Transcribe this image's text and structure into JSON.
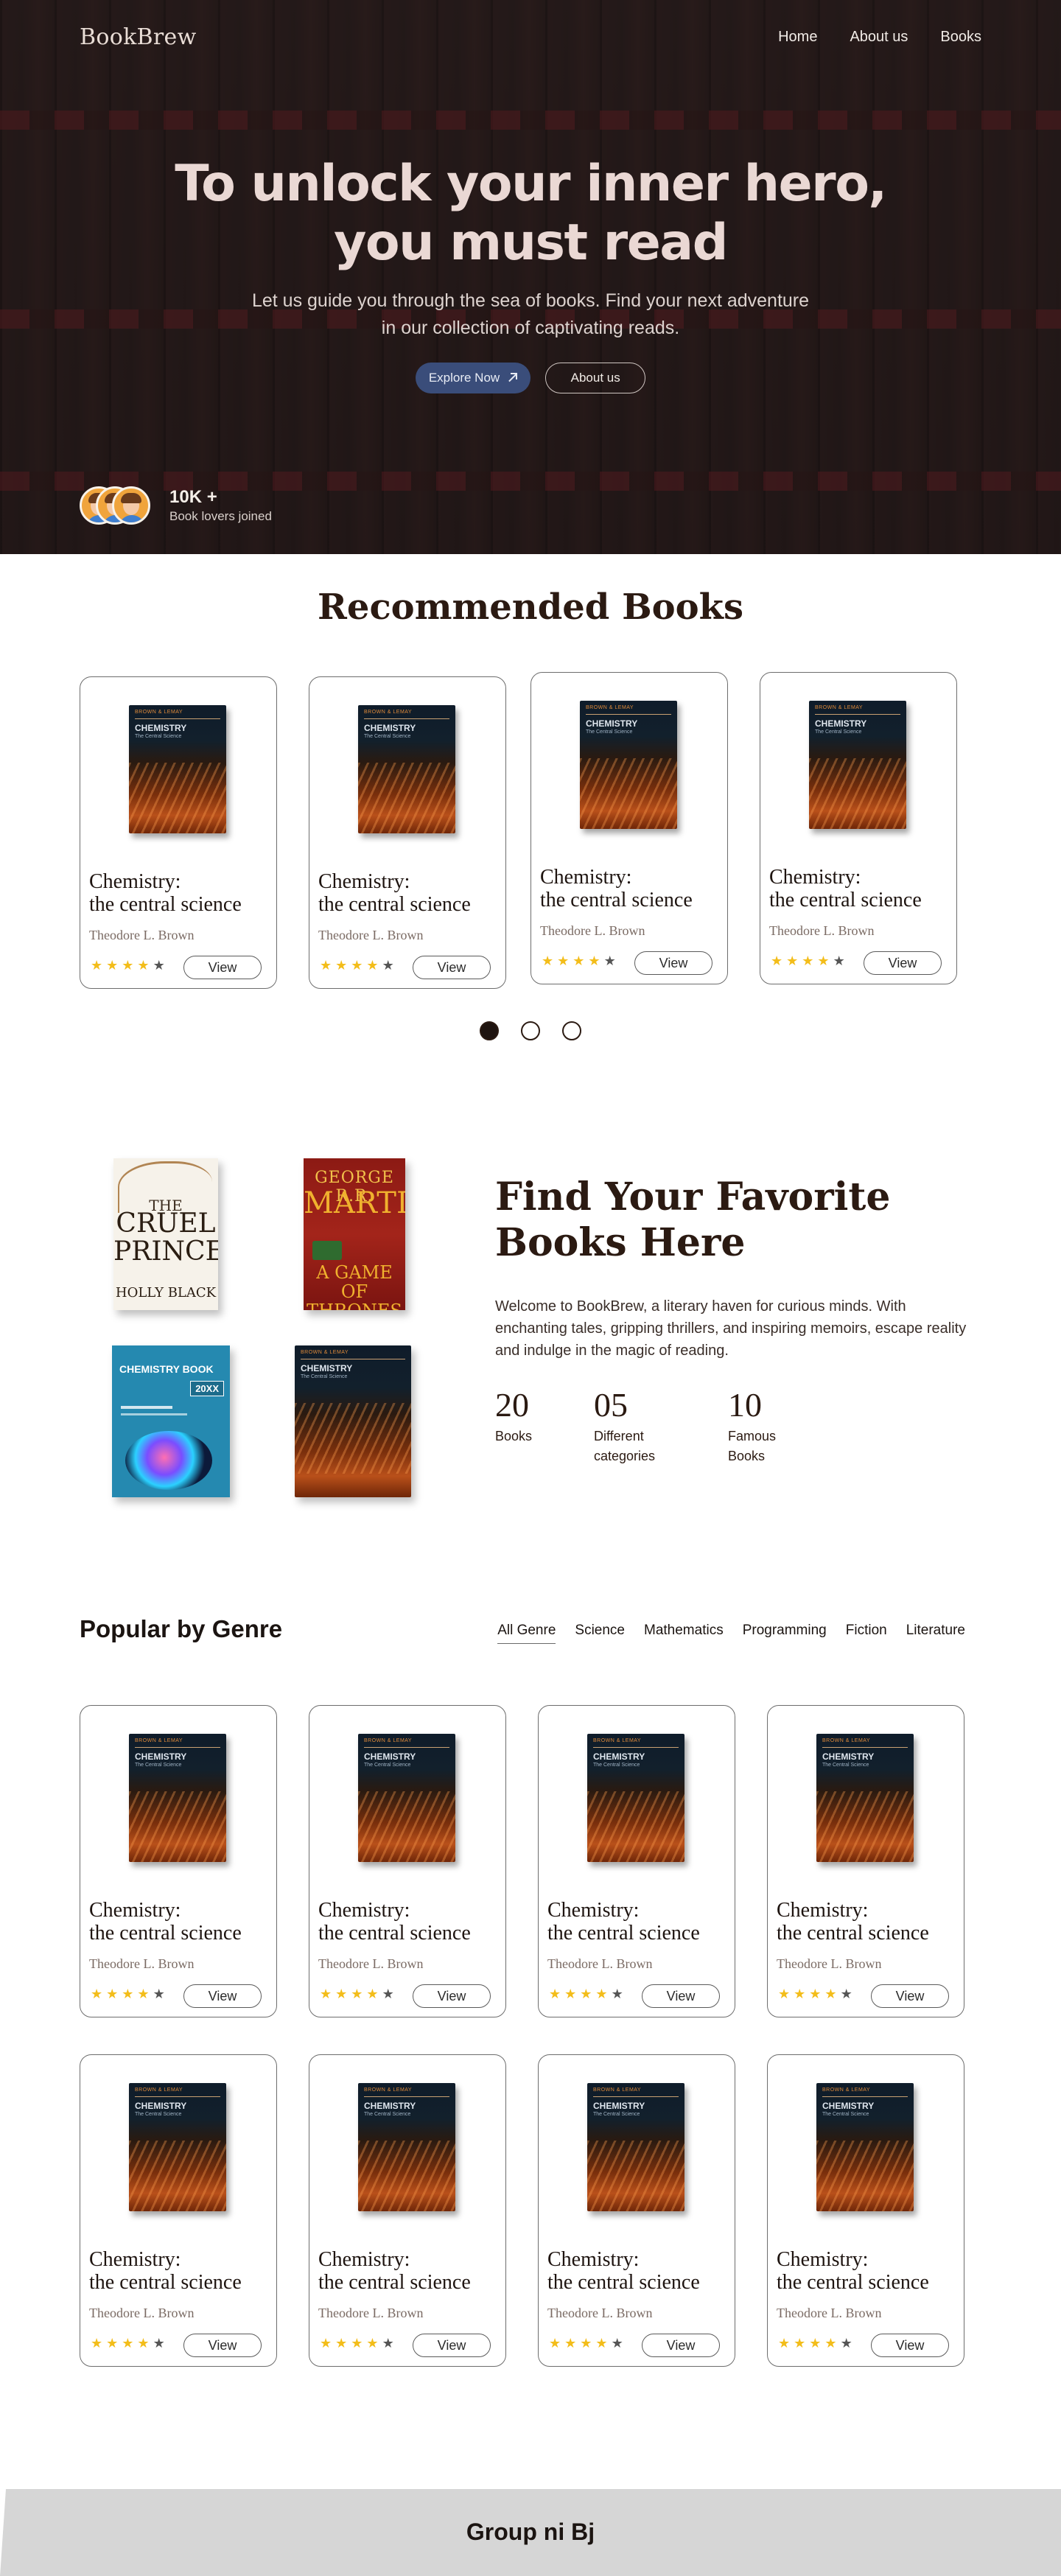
{
  "brand": {
    "logo": "BookBrew"
  },
  "nav": {
    "links": [
      "Home",
      "About us",
      "Books"
    ]
  },
  "hero": {
    "title_line1": "To unlock your inner hero,",
    "title_line2": "you must read",
    "subtitle": "Let us guide you through the sea of books. Find your next adventure in our collection of captivating reads.",
    "explore_label": "Explore Now",
    "about_label": "About us",
    "joined_count": "10K +",
    "joined_label": "Book lovers joined"
  },
  "recommended": {
    "title": "Recommended Books",
    "books": [
      {
        "title_line1": "Chemistry:",
        "title_line2": "the central science",
        "author": "Theodore L. Brown",
        "rating": 4,
        "view_label": "View"
      },
      {
        "title_line1": "Chemistry:",
        "title_line2": "the central science",
        "author": "Theodore L. Brown",
        "rating": 4,
        "view_label": "View"
      },
      {
        "title_line1": "Chemistry:",
        "title_line2": "the central science",
        "author": "Theodore L. Brown",
        "rating": 4,
        "view_label": "View"
      },
      {
        "title_line1": "Chemistry:",
        "title_line2": "the central science",
        "author": "Theodore L. Brown",
        "rating": 4,
        "view_label": "View"
      }
    ],
    "carousel_pages": 3,
    "active_page": 1
  },
  "cover_art": {
    "chem_authors": "BROWN & LEMAY",
    "chem_title": "CHEMISTRY",
    "chem_sub": "The Central Science",
    "cruel_the": "THE",
    "cruel_title": "CRUEL PRINCE",
    "cruel_author": "HOLLY BLACK",
    "thrones_author": "GEORGE R.R.",
    "thrones_name": "MARTIN",
    "thrones_title": "A GAME OF THRONES",
    "chembook_title": "CHEMISTRY BOOK",
    "chembook_year": "20XX"
  },
  "favorite": {
    "title_line1": "Find Your Favorite",
    "title_line2": "Books Here",
    "description": "Welcome to BookBrew, a literary haven for curious minds. With enchanting tales, gripping thrillers, and inspiring memoirs, escape reality and indulge in the magic of reading.",
    "stats": [
      {
        "number": "20",
        "label_line1": "Books",
        "label_line2": ""
      },
      {
        "number": "05",
        "label_line1": "Different",
        "label_line2": "categories"
      },
      {
        "number": "10",
        "label_line1": "Famous",
        "label_line2": "Books"
      }
    ]
  },
  "genre": {
    "title": "Popular by Genre",
    "tabs": [
      "All Genre",
      "Science",
      "Mathematics",
      "Programming",
      "Fiction",
      "Literature"
    ],
    "active_tab": "All Genre",
    "books": [
      {
        "title_line1": "Chemistry:",
        "title_line2": "the central science",
        "author": "Theodore L. Brown",
        "rating": 4,
        "view_label": "View"
      },
      {
        "title_line1": "Chemistry:",
        "title_line2": "the central science",
        "author": "Theodore L. Brown",
        "rating": 4,
        "view_label": "View"
      },
      {
        "title_line1": "Chemistry:",
        "title_line2": "the central science",
        "author": "Theodore L. Brown",
        "rating": 4,
        "view_label": "View"
      },
      {
        "title_line1": "Chemistry:",
        "title_line2": "the central science",
        "author": "Theodore L. Brown",
        "rating": 4,
        "view_label": "View"
      },
      {
        "title_line1": "Chemistry:",
        "title_line2": "the central science",
        "author": "Theodore L. Brown",
        "rating": 4,
        "view_label": "View"
      },
      {
        "title_line1": "Chemistry:",
        "title_line2": "the central science",
        "author": "Theodore L. Brown",
        "rating": 4,
        "view_label": "View"
      },
      {
        "title_line1": "Chemistry:",
        "title_line2": "the central science",
        "author": "Theodore L. Brown",
        "rating": 4,
        "view_label": "View"
      },
      {
        "title_line1": "Chemistry:",
        "title_line2": "the central science",
        "author": "Theodore L. Brown",
        "rating": 4,
        "view_label": "View"
      }
    ]
  },
  "footer": {
    "text": "Group ni Bj"
  },
  "colors": {
    "accent": "#3a4d7a",
    "star": "#f3bd1a",
    "star_off": "#555555",
    "text_dark": "#2b1a12",
    "footer_bg": "#d6d6d6"
  }
}
